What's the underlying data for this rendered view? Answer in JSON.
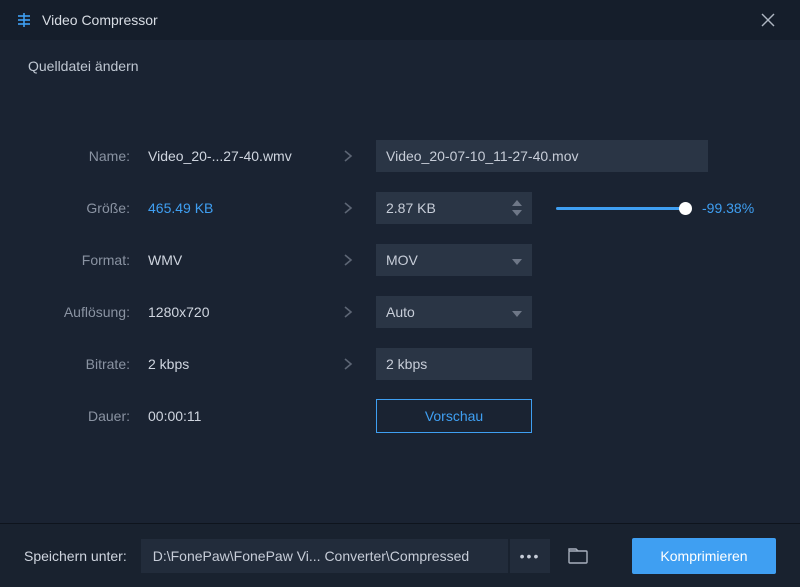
{
  "titlebar": {
    "title": "Video Compressor"
  },
  "subheader": "Quelldatei ändern",
  "labels": {
    "name": "Name:",
    "size": "Größe:",
    "format": "Format:",
    "resolution": "Auflösung:",
    "bitrate": "Bitrate:",
    "duration": "Dauer:"
  },
  "original": {
    "name": "Video_20-...27-40.wmv",
    "size": "465.49 KB",
    "format": "WMV",
    "resolution": "1280x720",
    "bitrate": "2 kbps",
    "duration": "00:00:11"
  },
  "target": {
    "name": "Video_20-07-10_11-27-40.mov",
    "size": "2.87 KB",
    "format": "MOV",
    "resolution": "Auto",
    "bitrate": "2 kbps"
  },
  "reduction_pct": "-99.38%",
  "buttons": {
    "preview": "Vorschau",
    "compress": "Komprimieren"
  },
  "footer": {
    "label": "Speichern unter:",
    "path": "D:\\FonePaw\\FonePaw Vi... Converter\\Compressed",
    "more": "•••"
  }
}
